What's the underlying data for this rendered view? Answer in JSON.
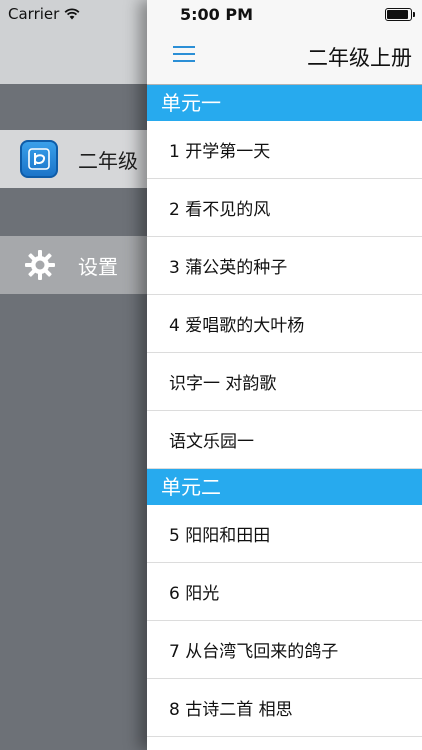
{
  "status": {
    "carrier": "Carrier",
    "time": "5:00 PM"
  },
  "drawer": {
    "items": [
      {
        "label": "二年级",
        "icon": "book-app-icon"
      },
      {
        "label": "设置",
        "icon": "gear-icon"
      }
    ]
  },
  "nav": {
    "title": "二年级上册",
    "menu_icon": "hamburger-menu-icon"
  },
  "sections": [
    {
      "title": "单元一",
      "rows": [
        "1 开学第一天",
        "2 看不见的风",
        "3 蒲公英的种子",
        "4 爱唱歌的大叶杨",
        "识字一 对韵歌",
        "语文乐园一"
      ]
    },
    {
      "title": "单元二",
      "rows": [
        "5 阳阳和田田",
        "6 阳光",
        "7 从台湾飞回来的鸽子",
        "8 古诗二首 相思"
      ]
    }
  ],
  "colors": {
    "section_header": "#27aaee",
    "accent": "#2b8fd6"
  }
}
